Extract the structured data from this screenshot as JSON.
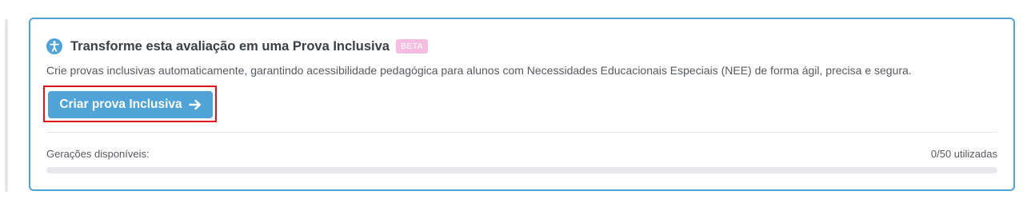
{
  "card": {
    "title": "Transforme esta avaliação em uma Prova Inclusiva",
    "badge": "BETA",
    "description": "Crie provas inclusivas automaticamente, garantindo acessibilidade pedagógica para alunos com Necessidades Educacionais Especiais (NEE) de forma ágil, precisa e segura.",
    "cta_label": "Criar prova Inclusiva",
    "cta_icon": "arrow-right-icon",
    "header_icon": "accessibility-icon",
    "usage_label": "Gerações disponíveis:",
    "usage_count": "0/50 utilizadas",
    "usage_fraction": 0
  },
  "colors": {
    "accent": "#4fa3d6",
    "badge_bg": "#f7bde0",
    "highlight": "#e0141e"
  }
}
